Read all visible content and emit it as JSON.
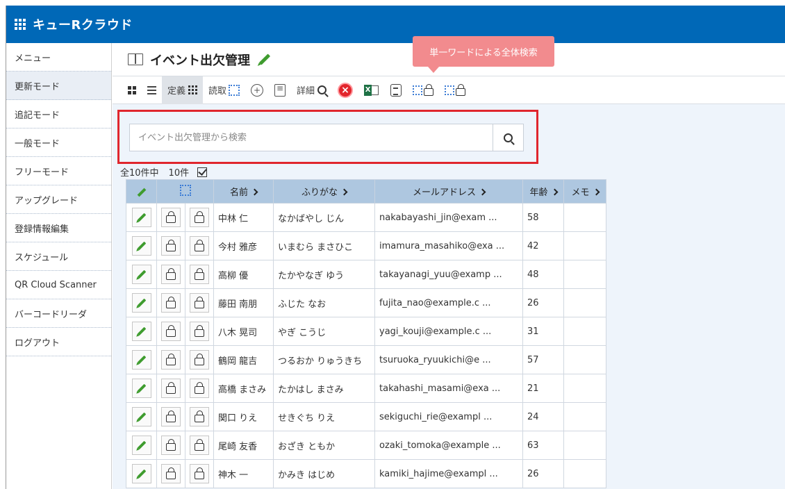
{
  "app": {
    "brand": "キューRクラウド"
  },
  "sidebar": {
    "items": [
      {
        "label": "メニュー",
        "active": false
      },
      {
        "label": "更新モード",
        "active": true
      },
      {
        "label": "追記モード",
        "active": false
      },
      {
        "label": "一般モード",
        "active": false
      },
      {
        "label": "フリーモード",
        "active": false
      },
      {
        "label": "アップグレード",
        "active": false
      },
      {
        "label": "登録情報編集",
        "active": false
      },
      {
        "label": "スケジュール",
        "active": false
      },
      {
        "label": "QR Cloud Scanner",
        "active": false
      },
      {
        "label": "バーコードリーダ",
        "active": false
      },
      {
        "label": "ログアウト",
        "active": false
      }
    ]
  },
  "page": {
    "title": "イベント出欠管理"
  },
  "tooltip": {
    "text": "単一ワードによる全体検索"
  },
  "toolbar": {
    "definition_label": "定義",
    "read_label": "読取",
    "detail_label": "詳細"
  },
  "search": {
    "placeholder": "イベント出欠管理から検索",
    "value": ""
  },
  "summary": {
    "total_text": "全10件中",
    "shown_text": "10件"
  },
  "table": {
    "headers": {
      "name": "名前",
      "furigana": "ふりがな",
      "email": "メールアドレス",
      "age": "年齢",
      "memo": "メモ"
    },
    "rows": [
      {
        "name": "中林 仁",
        "furigana": "なかばやし じん",
        "email": "nakabayashi_jin@exam ...",
        "age": "58",
        "memo": ""
      },
      {
        "name": "今村 雅彦",
        "furigana": "いまむら まさひこ",
        "email": "imamura_masahiko@exa ...",
        "age": "42",
        "memo": ""
      },
      {
        "name": "高柳 優",
        "furigana": "たかやなぎ ゆう",
        "email": "takayanagi_yuu@examp ...",
        "age": "48",
        "memo": ""
      },
      {
        "name": "藤田 南朋",
        "furigana": "ふじた なお",
        "email": "fujita_nao@example.c ...",
        "age": "26",
        "memo": ""
      },
      {
        "name": "八木 晃司",
        "furigana": "やぎ こうじ",
        "email": "yagi_kouji@example.c ...",
        "age": "31",
        "memo": ""
      },
      {
        "name": "鶴岡 龍吉",
        "furigana": "つるおか りゅうきち",
        "email": "tsuruoka_ryuukichi@e ...",
        "age": "57",
        "memo": ""
      },
      {
        "name": "高橋 まさみ",
        "furigana": "たかはし まさみ",
        "email": "takahashi_masami@exa ...",
        "age": "21",
        "memo": ""
      },
      {
        "name": "関口 りえ",
        "furigana": "せきぐち りえ",
        "email": "sekiguchi_rie@exampl ...",
        "age": "24",
        "memo": ""
      },
      {
        "name": "尾崎 友香",
        "furigana": "おざき ともか",
        "email": "ozaki_tomoka@example ...",
        "age": "63",
        "memo": ""
      },
      {
        "name": "神木 一",
        "furigana": "かみき はじめ",
        "email": "kamiki_hajime@exampl ...",
        "age": "26",
        "memo": ""
      }
    ]
  },
  "colors": {
    "header_bar": "#0068b7",
    "table_header": "#aec7e0",
    "highlight_border": "#e0262d",
    "tooltip": "#f28b8e",
    "pencil": "#3f9c2f"
  }
}
